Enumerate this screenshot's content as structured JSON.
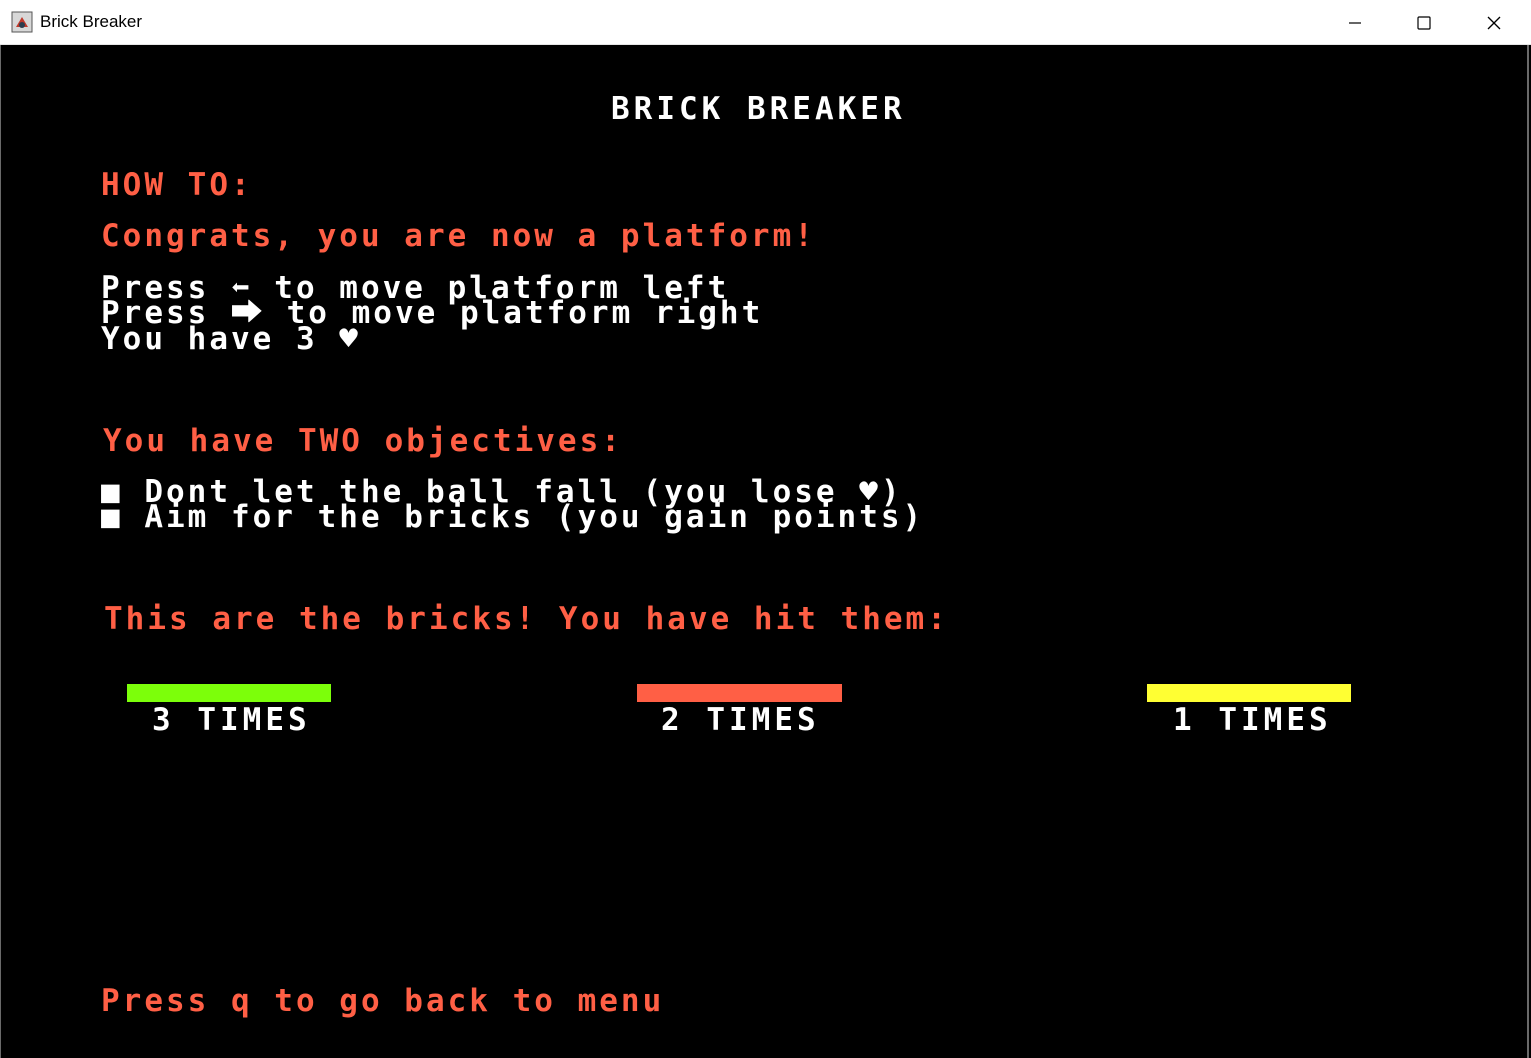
{
  "window": {
    "title": "Brick Breaker",
    "icons": {
      "app": "java-app-icon",
      "minimize": "minimize-icon",
      "maximize": "maximize-icon",
      "close": "close-icon"
    }
  },
  "screen": {
    "title": "BRICK BREAKER",
    "howto_heading": "HOW TO:",
    "congrats": "Congrats, you are now a platform!",
    "controls": [
      "Press ⬅ to move platform left",
      "Press ⮕ to move platform right"
    ],
    "lives": "You have 3 ♥",
    "objectives_heading": "You have TWO objectives:",
    "objectives": [
      "■ Dont let the ball fall (you lose ♥)",
      "■ Aim for the bricks (you gain points)"
    ],
    "bricks_heading": "This are the bricks! You have hit them:",
    "bricks": [
      {
        "label": "3 TIMES",
        "color": "#7cff0a"
      },
      {
        "label": "2 TIMES",
        "color": "#ff5f45"
      },
      {
        "label": "1 TIMES",
        "color": "#ffff33"
      }
    ],
    "back_hint": "Press q to go back to menu"
  },
  "colors": {
    "background": "#000000",
    "text_primary": "#ffffff",
    "text_accent": "#ff5f45"
  }
}
